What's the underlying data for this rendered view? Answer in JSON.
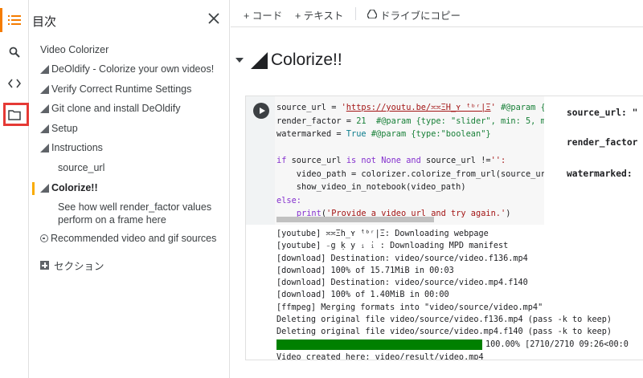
{
  "toc": {
    "title": "目次",
    "items": [
      {
        "label": "Video Colorizer"
      },
      {
        "label": "DeOldify - Colorize your own videos!"
      },
      {
        "label": "Verify Correct Runtime Settings"
      },
      {
        "label": "Git clone and install DeOldify"
      },
      {
        "label": "Setup"
      },
      {
        "label": "Instructions"
      },
      {
        "label": "source_url"
      },
      {
        "label": "Colorize!!"
      },
      {
        "label": "See how well render_factor values perform on a frame here"
      },
      {
        "label": "Recommended video and gif sources"
      },
      {
        "label": "セクション"
      }
    ]
  },
  "toolbar": {
    "code_label": "+ コード",
    "text_label": "+ テキスト",
    "drive_label": "ドライブにコピー"
  },
  "section": {
    "heading": "Colorize!!"
  },
  "code": {
    "l1a": "source_url = ",
    "l1b": "'",
    "l1c": "https://youtu.be/≍≍ΞΗ_ʏ ̇ᵗᵇʳ|Ξ",
    "l1d": "'",
    "l1e": " #@param {typ",
    "l2a": "render_factor = ",
    "l2b": "21",
    "l2c": "  #@param {type: \"slider\", min: 5, max",
    "l3a": "watermarked = ",
    "l3b": "True",
    "l3c": " #@param {type:\"boolean\"}",
    "l5a": "if",
    "l5b": " source_url ",
    "l5c": "is not None and",
    "l5d": " source_url !=",
    "l5e": "'':",
    "l6": "    video_path = colorizer.colorize_from_url(source_url, ",
    "l7": "    show_video_in_notebook(video_path)",
    "l8": "else:",
    "l9a": "    ",
    "l9b": "print",
    "l9c": "(",
    "l9d": "'Provide a video url and try again.'",
    "l9e": ")"
  },
  "form": {
    "f1": "source_url: \"",
    "f2": "render_factor",
    "f3": "watermarked:"
  },
  "output": {
    "lines": [
      "[youtube] ≍≍Ξh_ʏ ̇ᵗᵇʳ|Ξ: Downloading webpage",
      "[youtube] ₋g ḳ y ᵢ ̇ᵢ : Downloading MPD manifest",
      "[download] Destination: video/source/video.f136.mp4",
      "[download] 100% of 15.71MiB in 00:03",
      "[download] Destination: video/source/video.mp4.f140",
      "[download] 100% of 1.40MiB in 00:00",
      "[ffmpeg] Merging formats into \"video/source/video.mp4\"",
      "Deleting original file video/source/video.f136.mp4 (pass -k to keep)",
      "Deleting original file video/source/video.mp4.f140 (pass -k to keep)"
    ],
    "progress_fraction": 1.0,
    "progress_label": "100.00% [2710/2710 09:26<00:0",
    "final_line": "Video created here: video/result/video.mp4"
  },
  "colors": {
    "accent_orange": "#f57c00",
    "highlight_red": "#e53935",
    "active_yellow": "#f9ab00",
    "progress_green": "#008000"
  },
  "icons": [
    "list-icon",
    "search-icon",
    "code-icon",
    "folder-icon",
    "close-icon",
    "drive-icon",
    "run-icon"
  ]
}
